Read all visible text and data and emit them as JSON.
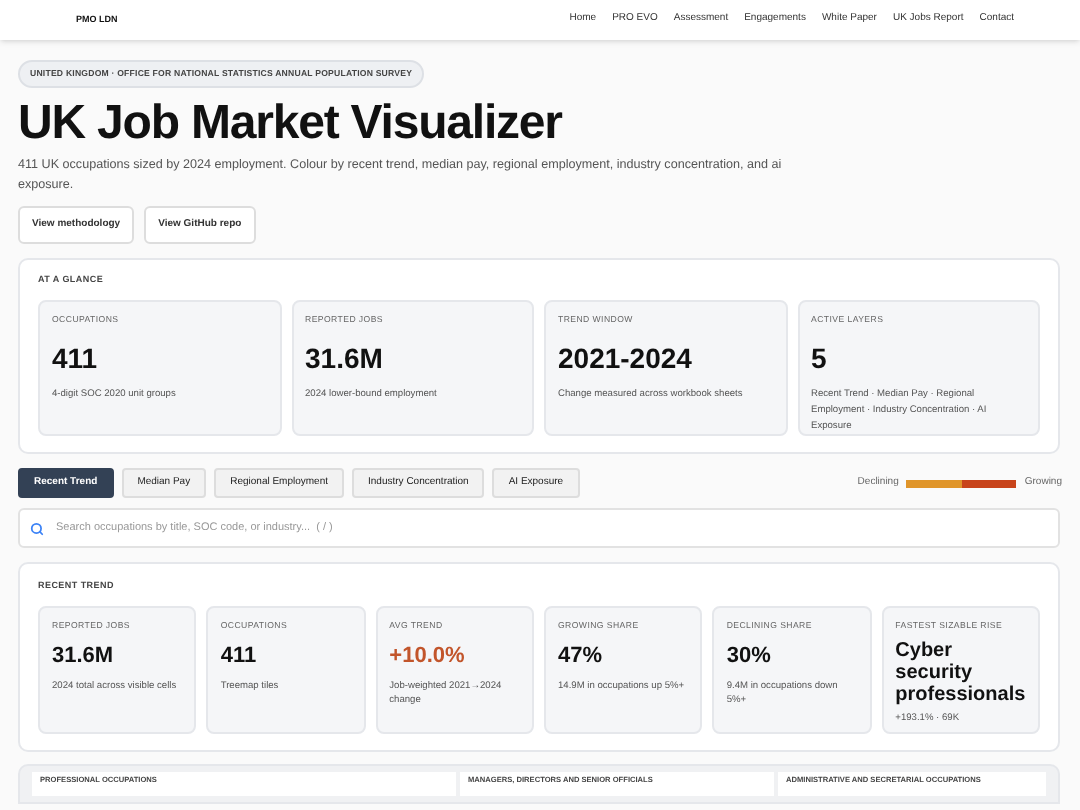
{
  "brand": "PMO LDN",
  "nav": [
    "Home",
    "PRO EVO",
    "Assessment",
    "Engagements",
    "White Paper",
    "UK Jobs Report",
    "Contact"
  ],
  "eyebrow": "UNITED KINGDOM · OFFICE FOR NATIONAL STATISTICS ANNUAL POPULATION SURVEY",
  "title": "UK Job Market Visualizer",
  "description": "411 UK occupations sized by 2024 employment. Colour by recent trend, median pay, regional employment, industry concentration, and ai exposure.",
  "actions": [
    "View methodology",
    "View GitHub repo"
  ],
  "glance": {
    "heading": "AT A GLANCE",
    "cards": [
      {
        "label": "OCCUPATIONS",
        "value": "411",
        "note": "4-digit SOC 2020 unit groups"
      },
      {
        "label": "REPORTED JOBS",
        "value": "31.6M",
        "note": "2024 lower-bound employment"
      },
      {
        "label": "TREND WINDOW",
        "value": "2021-2024",
        "note": "Change measured across workbook sheets"
      },
      {
        "label": "ACTIVE LAYERS",
        "value": "5",
        "note": "Recent Trend · Median Pay · Regional Employment · Industry Concentration · AI Exposure"
      }
    ]
  },
  "layers": [
    {
      "label": "Recent Trend",
      "selected": true
    },
    {
      "label": "Median Pay",
      "selected": false
    },
    {
      "label": "Regional Employment",
      "selected": false
    },
    {
      "label": "Industry Concentration",
      "selected": false
    },
    {
      "label": "AI Exposure",
      "selected": false
    }
  ],
  "legend": {
    "low": "Declining",
    "high": "Growing"
  },
  "search": {
    "placeholder": "Search occupations by title, SOC code, or industry...  ( / )"
  },
  "trend": {
    "heading": "RECENT TREND",
    "cards": [
      {
        "label": "REPORTED JOBS",
        "value": "31.6M",
        "note": "2024 total across visible cells",
        "kind": "plain"
      },
      {
        "label": "OCCUPATIONS",
        "value": "411",
        "note": "Treemap tiles",
        "kind": "plain"
      },
      {
        "label": "AVG TREND",
        "value": "+10.0%",
        "note": "Job-weighted 2021→2024 change",
        "kind": "accent"
      },
      {
        "label": "GROWING SHARE",
        "value": "47%",
        "note": "14.9M in occupations up 5%+",
        "kind": "plain"
      },
      {
        "label": "DECLINING SHARE",
        "value": "30%",
        "note": "9.4M in occupations down 5%+",
        "kind": "plain"
      },
      {
        "label": "FASTEST SIZABLE RISE",
        "value": "Cyber security professionals",
        "note": "+193.1% · 69K",
        "kind": "wrap"
      }
    ]
  },
  "treemap_groups": [
    "PROFESSIONAL OCCUPATIONS",
    "MANAGERS, DIRECTORS AND SENIOR OFFICIALS",
    "ADMINISTRATIVE AND SECRETARIAL OCCUPATIONS"
  ]
}
